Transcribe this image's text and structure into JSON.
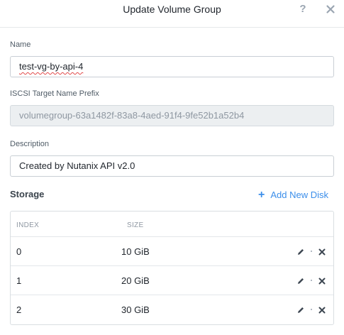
{
  "dialog": {
    "title": "Update Volume Group",
    "help_icon": "question-mark-icon",
    "close_icon": "close-icon",
    "help_glyph": "?"
  },
  "form": {
    "name_label": "Name",
    "name_value": "test-vg-by-api-4",
    "iscsi_label": "ISCSI Target Name Prefix",
    "iscsi_value": "volumegroup-63a1482f-83a8-4aed-91f4-9fe52b1a52b4",
    "description_label": "Description",
    "description_value": "Created by Nutanix API v2.0"
  },
  "storage": {
    "title": "Storage",
    "add_disk_icon": "plus-icon",
    "add_disk_glyph": "+",
    "add_disk_label": "Add New Disk",
    "columns": [
      "INDEX",
      "SIZE"
    ],
    "rows": [
      {
        "index": "0",
        "size": "10 GiB"
      },
      {
        "index": "1",
        "size": "20 GiB"
      },
      {
        "index": "2",
        "size": "30 GiB"
      }
    ],
    "row_icons": [
      "pencil-icon",
      "close-icon"
    ]
  },
  "colors": {
    "accent": "#3b8eea",
    "icon": "#3d4752",
    "muted_icon": "#9aa5b1"
  }
}
